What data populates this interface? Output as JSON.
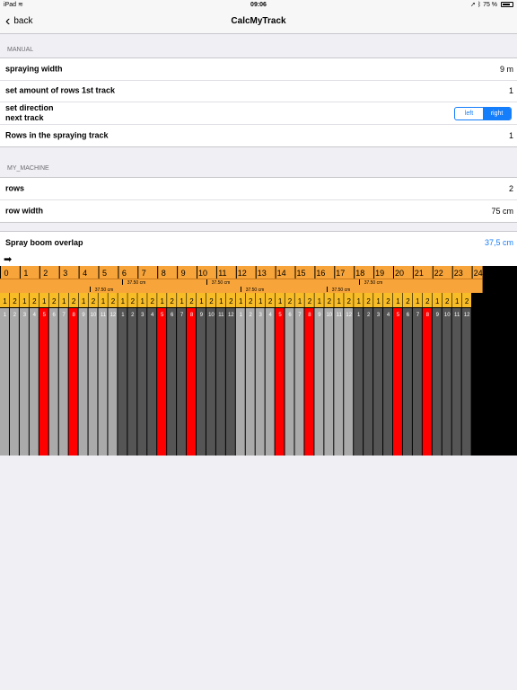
{
  "status": {
    "device": "iPad",
    "time": "09:06",
    "battery": "75 %"
  },
  "nav": {
    "back_label": "back",
    "title": "CalcMyTrack"
  },
  "manual": {
    "header": "MANUAL",
    "spraying_width_label": "spraying width",
    "spraying_width_value": "9 m",
    "rows_first_label": "set amount of rows 1st track",
    "rows_first_value": "1",
    "direction_label_1": "set direction",
    "direction_label_2": "next track",
    "direction_left": "left",
    "direction_right": "right",
    "direction_selected": "right",
    "rows_in_track_label": "Rows in the spraying track",
    "rows_in_track_value": "1"
  },
  "machine": {
    "header": "MY_MACHINE",
    "rows_label": "rows",
    "rows_value": "2",
    "row_width_label": "row width",
    "row_width_value": "75 cm"
  },
  "overlap": {
    "label": "Spray boom overlap",
    "value": "37,5 cm"
  },
  "track": {
    "meter_labels": [
      "0",
      "1",
      "2",
      "3",
      "4",
      "5",
      "6",
      "7",
      "8",
      "9",
      "10",
      "11",
      "12",
      "13",
      "14",
      "15",
      "16",
      "17",
      "18",
      "19",
      "20",
      "21",
      "22",
      "23",
      "24"
    ],
    "overlap_text": "37.50 cm",
    "pair_labels": [
      "1",
      "2"
    ],
    "row_numbers": [
      "1",
      "2",
      "3",
      "4",
      "5",
      "6",
      "7",
      "8",
      "9",
      "10",
      "11",
      "12"
    ],
    "marked_rows": [
      5,
      8
    ],
    "colors": {
      "orange": "#f7a43a",
      "yellow": "#f8bd26",
      "light": "#aaaaaa",
      "dark": "#555555",
      "red": "#ff0000",
      "black": "#000000"
    }
  }
}
